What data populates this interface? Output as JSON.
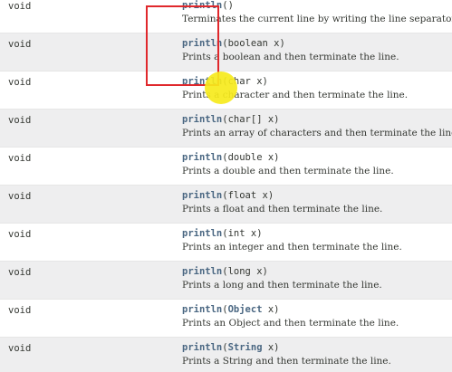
{
  "methods": [
    {
      "modifier": "void",
      "name": "println",
      "params_pre": "(",
      "param_type": "",
      "params_post": ")",
      "description": "Terminates the current line by writing the line separator"
    },
    {
      "modifier": "void",
      "name": "println",
      "params_pre": "(boolean x)",
      "param_type": "",
      "params_post": "",
      "description": "Prints a boolean and then terminate the line."
    },
    {
      "modifier": "void",
      "name": "println",
      "params_pre": "(char x)",
      "param_type": "",
      "params_post": "",
      "description": "Prints a character and then terminate the line."
    },
    {
      "modifier": "void",
      "name": "println",
      "params_pre": "(char[] x)",
      "param_type": "",
      "params_post": "",
      "description": "Prints an array of characters and then terminate the line."
    },
    {
      "modifier": "void",
      "name": "println",
      "params_pre": "(double x)",
      "param_type": "",
      "params_post": "",
      "description": "Prints a double and then terminate the line."
    },
    {
      "modifier": "void",
      "name": "println",
      "params_pre": "(float x)",
      "param_type": "",
      "params_post": "",
      "description": "Prints a float and then terminate the line."
    },
    {
      "modifier": "void",
      "name": "println",
      "params_pre": "(int x)",
      "param_type": "",
      "params_post": "",
      "description": "Prints an integer and then terminate the line."
    },
    {
      "modifier": "void",
      "name": "println",
      "params_pre": "(long x)",
      "param_type": "",
      "params_post": "",
      "description": "Prints a long and then terminate the line."
    },
    {
      "modifier": "void",
      "name": "println",
      "params_pre": "(",
      "param_type": "Object",
      "params_post": " x)",
      "description": "Prints an Object and then terminate the line."
    },
    {
      "modifier": "void",
      "name": "println",
      "params_pre": "(",
      "param_type": "String",
      "params_post": " x)",
      "description": "Prints a String and then terminate the line."
    }
  ],
  "colors": {
    "row_alt": "#eeeeef",
    "method_name": "#4a6782",
    "text": "#353833",
    "highlight_box": "#e0282c",
    "cursor": "#f6ea1c"
  }
}
